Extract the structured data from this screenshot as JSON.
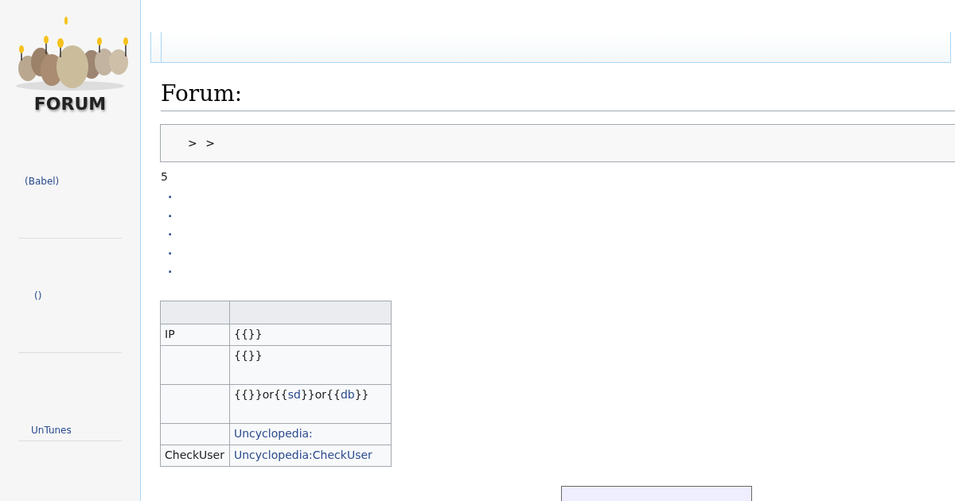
{
  "logo": {
    "text": "FORUM"
  },
  "sidebar": {
    "sections": [
      {
        "items": [
          {
            "label": "(Babel)"
          }
        ]
      },
      {
        "items": [
          {
            "label": "()"
          }
        ]
      },
      {
        "items": [
          {
            "label": "UnTunes"
          }
        ]
      }
    ]
  },
  "page": {
    "title": "Forum:",
    "breadcrumb": "> >",
    "count": "5",
    "bullets": [
      "·",
      "·",
      "·",
      "·",
      "·"
    ],
    "table": {
      "rows": [
        {
          "label": "IP",
          "value": [
            {
              "kind": "text",
              "text": "{{}}"
            }
          ],
          "tall": false
        },
        {
          "value": [
            {
              "kind": "text",
              "text": "{{}}"
            }
          ],
          "tall": true
        },
        {
          "value": [
            {
              "kind": "text",
              "text": "{{}}or{{"
            },
            {
              "kind": "link",
              "text": "sd"
            },
            {
              "kind": "text",
              "text": "}}or{{"
            },
            {
              "kind": "link",
              "text": "db"
            },
            {
              "kind": "text",
              "text": "}}"
            }
          ],
          "tall": true
        },
        {
          "value": [
            {
              "kind": "link",
              "text": "Uncyclopedia:"
            }
          ],
          "tall": false
        },
        {
          "label": "CheckUser",
          "value": [
            {
              "kind": "link",
              "text": "Uncyclopedia:CheckUser"
            }
          ],
          "tall": false
        }
      ]
    }
  }
}
